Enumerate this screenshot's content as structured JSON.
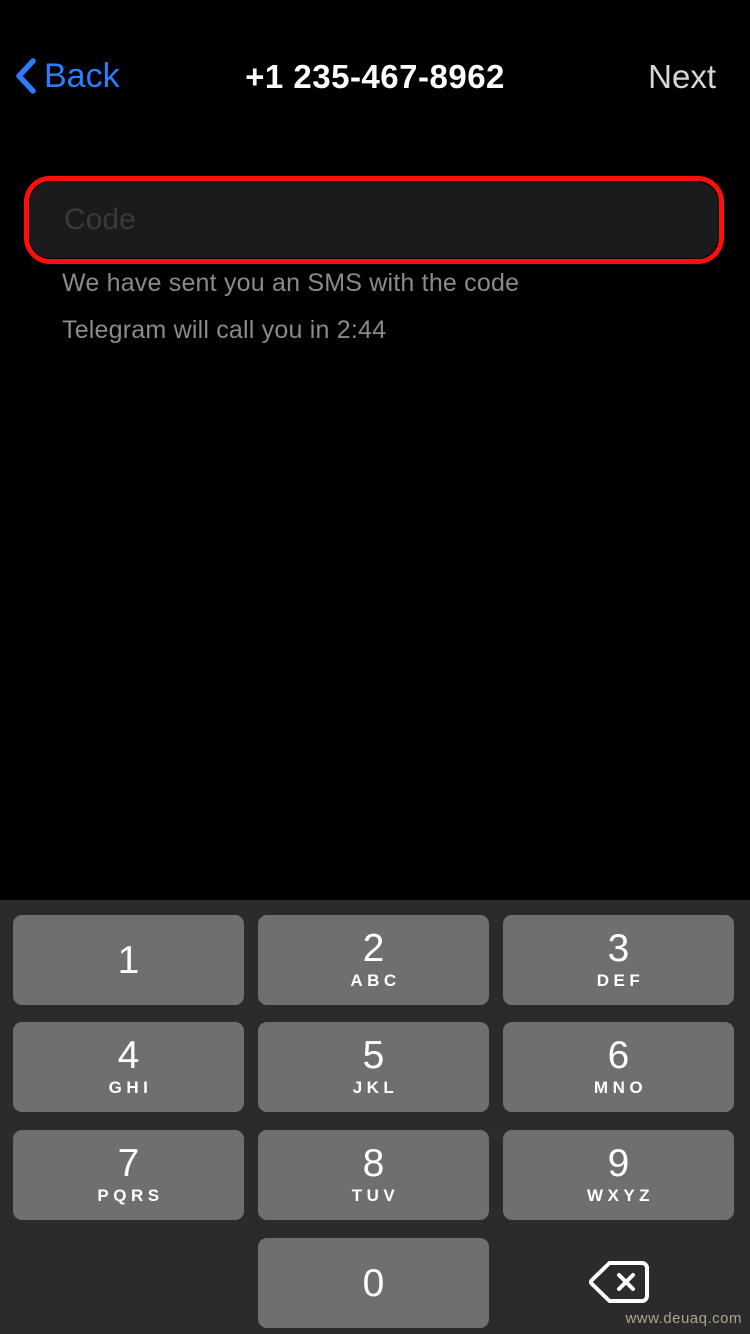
{
  "navbar": {
    "back_label": "Back",
    "back_icon": "chevron-left-icon",
    "title": "+1 235-467-8962",
    "next_label": "Next"
  },
  "code_field": {
    "placeholder": "Code",
    "value": "",
    "highlight_color": "#ff0e0e",
    "background": "#1b1b1d"
  },
  "hints": {
    "sms": "We have sent you an SMS with the code",
    "call": "Telegram will call you in 2:44"
  },
  "keypad": {
    "background": "#2b2b2b",
    "key_color": "#6f6f6f",
    "rows": [
      [
        {
          "digit": "1",
          "letters": ""
        },
        {
          "digit": "2",
          "letters": "ABC"
        },
        {
          "digit": "3",
          "letters": "DEF"
        }
      ],
      [
        {
          "digit": "4",
          "letters": "GHI"
        },
        {
          "digit": "5",
          "letters": "JKL"
        },
        {
          "digit": "6",
          "letters": "MNO"
        }
      ],
      [
        {
          "digit": "7",
          "letters": "PQRS"
        },
        {
          "digit": "8",
          "letters": "TUV"
        },
        {
          "digit": "9",
          "letters": "WXYZ"
        }
      ]
    ],
    "zero": {
      "digit": "0",
      "letters": ""
    },
    "backspace_icon": "backspace-delete-icon"
  },
  "watermark": "www.deuaq.com"
}
